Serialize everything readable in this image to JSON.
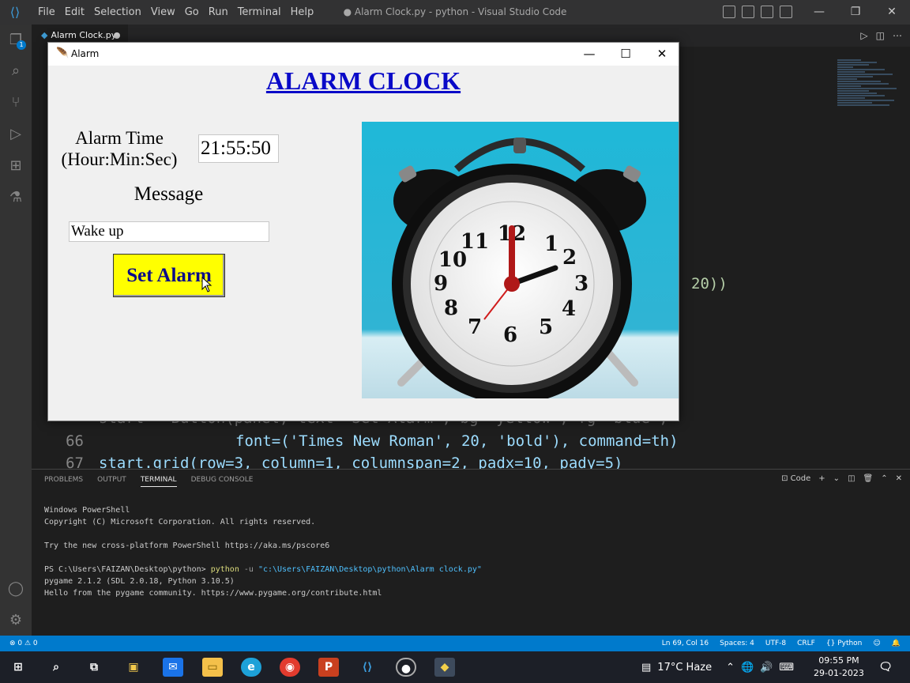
{
  "vscode": {
    "menu": [
      "File",
      "Edit",
      "Selection",
      "View",
      "Go",
      "Run",
      "Terminal",
      "Help"
    ],
    "window_title": "● Alarm Clock.py - python - Visual Studio Code",
    "tab_label": "Alarm Clock.py",
    "explorer_badge": "1",
    "code": {
      "line66_num": "66",
      "line66": "font=('Times New Roman', 20, 'bold'), command=th)",
      "line67_num": "67",
      "line67": "start.grid(row=3, column=1, columnspan=2, padx=10, pady=5)",
      "line65_partial": "start = Button(panel, text='Set Alarm', bg='yellow', fg='blue',",
      "visible_fragment": "20))"
    },
    "panel_tabs": [
      "PROBLEMS",
      "OUTPUT",
      "TERMINAL",
      "DEBUG CONSOLE"
    ],
    "panel_terminal_label": "Code",
    "terminal": {
      "l1": "Windows PowerShell",
      "l2": "Copyright (C) Microsoft Corporation. All rights reserved.",
      "l3": "Try the new cross-platform PowerShell https://aka.ms/pscore6",
      "prompt": "PS C:\\Users\\FAIZAN\\Desktop\\python> ",
      "cmd": "python",
      "flag": " -u ",
      "path": "\"c:\\Users\\FAIZAN\\Desktop\\python\\Alarm clock.py\"",
      "l5": "pygame 2.1.2 (SDL 2.0.18, Python 3.10.5)",
      "l6": "Hello from the pygame community. https://www.pygame.org/contribute.html"
    },
    "status": {
      "problems": "⊗ 0 ⚠ 0",
      "position": "Ln 69, Col 16",
      "spaces": "Spaces: 4",
      "encoding": "UTF-8",
      "eol": "CRLF",
      "language": "Python"
    }
  },
  "alarm_window": {
    "title": "Alarm",
    "heading": "ALARM CLOCK",
    "time_label_1": "Alarm Time",
    "time_label_2": "(Hour:Min:Sec)",
    "time_value": "21:55:50",
    "message_label": "Message",
    "message_value": "Wake up",
    "set_button": "Set Alarm"
  },
  "taskbar": {
    "weather": "17°C Haze",
    "time": "09:55 PM",
    "date": "29-01-2023"
  },
  "colors": {
    "heading": "#0a0ac8",
    "button_bg": "#ffff00",
    "button_fg": "#0a0a8a",
    "statusbar": "#007acc"
  }
}
